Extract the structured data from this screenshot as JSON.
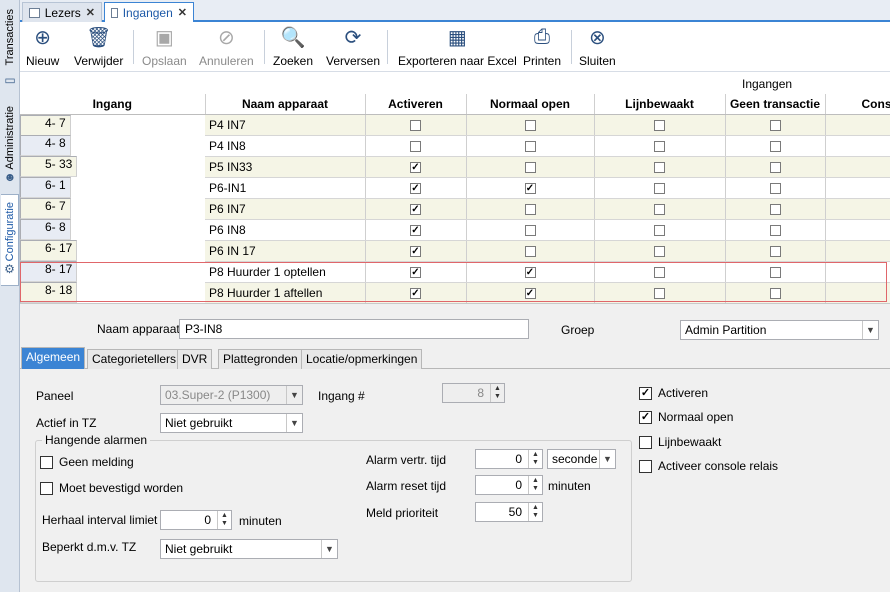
{
  "side_tabs": [
    {
      "label": "Transacties"
    },
    {
      "label": "Administratie"
    },
    {
      "label": "Configuratie"
    }
  ],
  "doc_tabs": [
    {
      "label": "Lezers"
    },
    {
      "label": "Ingangen"
    }
  ],
  "toolbar": {
    "new": "Nieuw",
    "delete": "Verwijder",
    "save": "Opslaan",
    "cancel": "Annuleren",
    "search": "Zoeken",
    "refresh": "Verversen",
    "export": "Exporteren naar Excel",
    "print": "Printen",
    "close": "Sluiten"
  },
  "grid": {
    "group_title": "Ingangen",
    "columns": [
      "Ingang",
      "Naam apparaat",
      "Activeren",
      "Normaal open",
      "Lijnbewaakt",
      "Geen transactie",
      "Cons"
    ],
    "rows": [
      {
        "ingang": "4- 7",
        "naam": "P4 IN7",
        "activeren": false,
        "normaal_open": false,
        "lijnbewaakt": false,
        "geen_transactie": false
      },
      {
        "ingang": "4- 8",
        "naam": "P4 IN8",
        "activeren": false,
        "normaal_open": false,
        "lijnbewaakt": false,
        "geen_transactie": false
      },
      {
        "ingang": "5- 33",
        "naam": "P5 IN33",
        "activeren": true,
        "normaal_open": false,
        "lijnbewaakt": false,
        "geen_transactie": false
      },
      {
        "ingang": "6- 1",
        "naam": "P6-IN1",
        "activeren": true,
        "normaal_open": true,
        "lijnbewaakt": false,
        "geen_transactie": false
      },
      {
        "ingang": "6- 7",
        "naam": "P6 IN7",
        "activeren": true,
        "normaal_open": false,
        "lijnbewaakt": false,
        "geen_transactie": false
      },
      {
        "ingang": "6- 8",
        "naam": "P6 IN8",
        "activeren": true,
        "normaal_open": false,
        "lijnbewaakt": false,
        "geen_transactie": false
      },
      {
        "ingang": "6- 17",
        "naam": "P6 IN 17",
        "activeren": true,
        "normaal_open": false,
        "lijnbewaakt": false,
        "geen_transactie": false
      },
      {
        "ingang": "8- 17",
        "naam": "P8 Huurder 1 optellen",
        "activeren": true,
        "normaal_open": true,
        "lijnbewaakt": false,
        "geen_transactie": false
      },
      {
        "ingang": "8- 18",
        "naam": "P8 Huurder 1 aftellen",
        "activeren": true,
        "normaal_open": true,
        "lijnbewaakt": false,
        "geen_transactie": false
      }
    ]
  },
  "detail": {
    "naam_label": "Naam apparaat",
    "naam_value": "P3-IN8",
    "groep_label": "Groep",
    "groep_value": "Admin Partition",
    "tabs": [
      "Algemeen",
      "Categorietellers",
      "DVR",
      "Plattegronden",
      "Locatie/opmerkingen"
    ],
    "paneel_label": "Paneel",
    "paneel_value": "03.Super-2 (P1300)",
    "ingang_nr_label": "Ingang #",
    "ingang_nr_value": "8",
    "actief_tz_label": "Actief in TZ",
    "actief_tz_value": "Niet gebruikt",
    "hangende_title": "Hangende alarmen",
    "geen_melding": "Geen melding",
    "moet_bevestigd": "Moet bevestigd worden",
    "herhaal_label": "Herhaal interval limiet",
    "herhaal_value": "0",
    "herhaal_unit": "minuten",
    "beperkt_label": "Beperkt d.m.v. TZ",
    "beperkt_value": "Niet gebruikt",
    "alarm_vertr_label": "Alarm vertr. tijd",
    "alarm_vertr_value": "0",
    "alarm_vertr_unit": "seconde",
    "alarm_reset_label": "Alarm reset tijd",
    "alarm_reset_value": "0",
    "alarm_reset_unit": "minuten",
    "meld_label": "Meld prioriteit",
    "meld_value": "50",
    "chk_activeren": "Activeren",
    "chk_normaal_open": "Normaal open",
    "chk_lijnbewaakt": "Lijnbewaakt",
    "chk_console": "Activeer console relais"
  }
}
